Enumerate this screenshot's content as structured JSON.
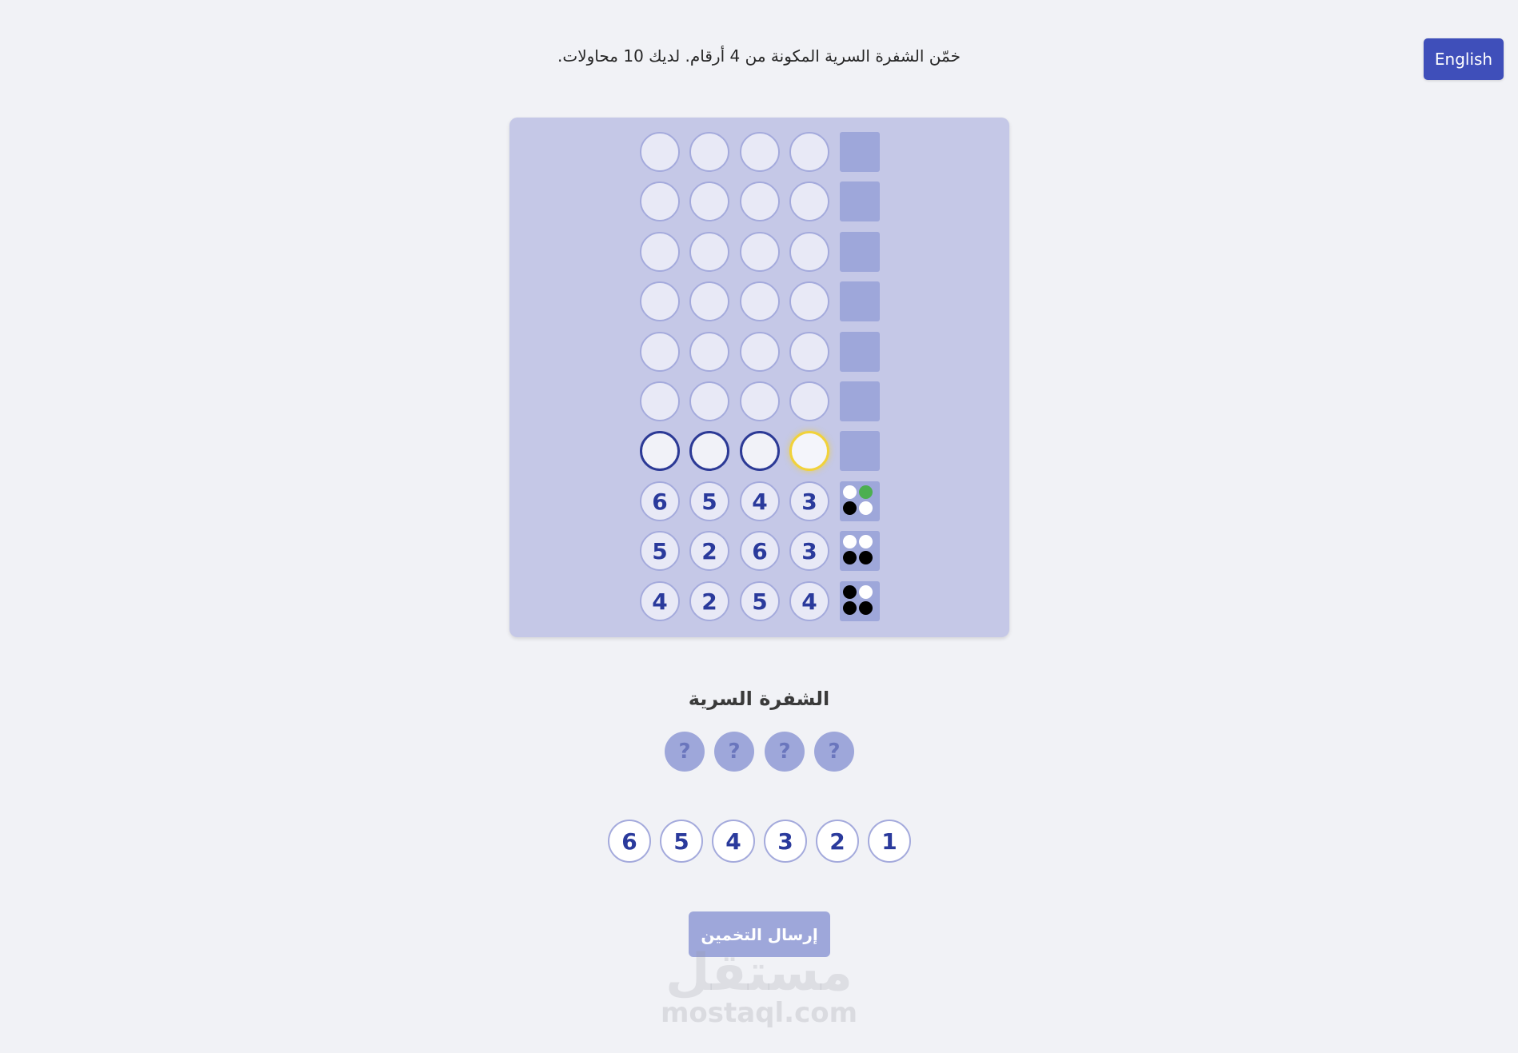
{
  "language_button": "English",
  "instructions": "خمّن الشفرة السرية المكونة من 4 أرقام. لديك 10 محاولات.",
  "board": {
    "rows": [
      {
        "state": "empty",
        "pegs": [
          "",
          "",
          "",
          ""
        ],
        "feedback": []
      },
      {
        "state": "empty",
        "pegs": [
          "",
          "",
          "",
          ""
        ],
        "feedback": []
      },
      {
        "state": "empty",
        "pegs": [
          "",
          "",
          "",
          ""
        ],
        "feedback": []
      },
      {
        "state": "empty",
        "pegs": [
          "",
          "",
          "",
          ""
        ],
        "feedback": []
      },
      {
        "state": "empty",
        "pegs": [
          "",
          "",
          "",
          ""
        ],
        "feedback": []
      },
      {
        "state": "empty",
        "pegs": [
          "",
          "",
          "",
          ""
        ],
        "feedback": []
      },
      {
        "state": "current",
        "active_peg": 3,
        "pegs": [
          "",
          "",
          "",
          ""
        ],
        "feedback": []
      },
      {
        "state": "guessed",
        "pegs": [
          "6",
          "5",
          "4",
          "3"
        ],
        "feedback": [
          "white",
          "green",
          "black",
          "white"
        ]
      },
      {
        "state": "guessed",
        "pegs": [
          "5",
          "2",
          "6",
          "3"
        ],
        "feedback": [
          "white",
          "white",
          "black",
          "black"
        ]
      },
      {
        "state": "guessed",
        "pegs": [
          "4",
          "2",
          "5",
          "4"
        ],
        "feedback": [
          "black",
          "white",
          "black",
          "black"
        ]
      }
    ]
  },
  "secret": {
    "title": "الشفرة السرية",
    "pegs": [
      "?",
      "?",
      "?",
      "?"
    ]
  },
  "number_buttons": [
    "6",
    "5",
    "4",
    "3",
    "2",
    "1"
  ],
  "submit_button": "إرسال التخمين",
  "watermark": {
    "logo": "مستقل",
    "text": "mostaql.com"
  },
  "colors": {
    "accent": "#3f4fba",
    "board_bg": "#c5c8e7",
    "peg_text": "#2a3a9c",
    "feedback_box": "#9ea7da",
    "active_peg_border": "#f1d23a",
    "correct_dot": "#4caf50"
  }
}
